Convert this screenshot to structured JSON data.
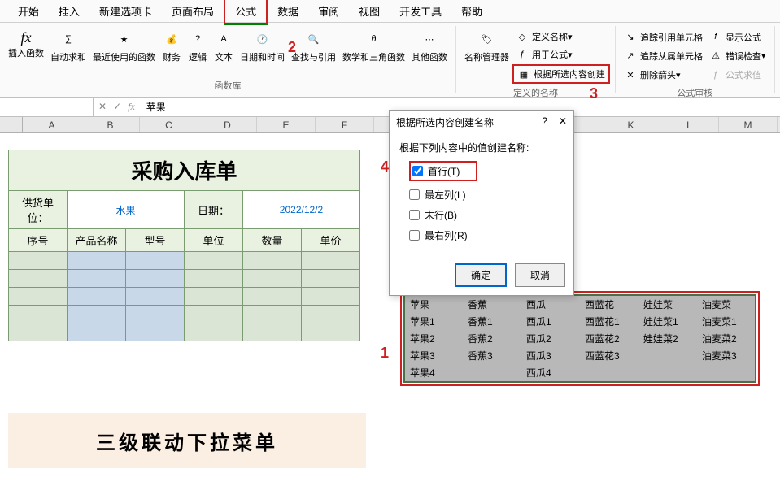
{
  "tabs": [
    "开始",
    "插入",
    "新建选项卡",
    "页面布局",
    "公式",
    "数据",
    "审阅",
    "视图",
    "开发工具",
    "帮助"
  ],
  "active_tab_index": 4,
  "ribbon": {
    "fx_insert": "插入函数",
    "autosum": "自动求和",
    "recent": "最近使用的函数",
    "financial": "财务",
    "logical": "逻辑",
    "text": "文本",
    "datetime": "日期和时间",
    "lookup": "查找与引用",
    "math": "数学和三角函数",
    "more": "其他函数",
    "group1_label": "函数库",
    "name_mgr": "名称管理器",
    "define_name": "定义名称",
    "use_in_formula": "用于公式",
    "create_from_selection": "根据所选内容创建",
    "group2_label": "定义的名称",
    "trace_precedents": "追踪引用单元格",
    "trace_dependents": "追踪从属单元格",
    "remove_arrows": "删除箭头",
    "show_formulas": "显示公式",
    "error_check": "错误检查",
    "evaluate": "公式求值",
    "group3_label": "公式审核"
  },
  "formula_bar": {
    "name_box": "",
    "value": "苹果"
  },
  "col_headers": [
    "A",
    "B",
    "C",
    "D",
    "E",
    "F",
    "K",
    "L",
    "M"
  ],
  "purchase": {
    "title": "采购入库单",
    "supplier_label": "供货单位：",
    "supplier_value": "水果",
    "date_label": "日期：",
    "date_value": "2022/12/2",
    "columns": [
      "序号",
      "产品名称",
      "型号",
      "单位",
      "数量",
      "单价"
    ]
  },
  "dialog": {
    "title": "根据所选内容创建名称",
    "help": "?",
    "close": "✕",
    "label": "根据下列内容中的值创建名称:",
    "opt1": "首行(T)",
    "opt2": "最左列(L)",
    "opt3": "末行(B)",
    "opt4": "最右列(R)",
    "ok": "确定",
    "cancel": "取消"
  },
  "chart_data": {
    "type": "table",
    "headers": [
      "苹果",
      "香蕉",
      "西瓜",
      "西蓝花",
      "娃娃菜",
      "油麦菜"
    ],
    "rows": [
      [
        "苹果1",
        "香蕉1",
        "西瓜1",
        "西蓝花1",
        "娃娃菜1",
        "油麦菜1"
      ],
      [
        "苹果2",
        "香蕉2",
        "西瓜2",
        "西蓝花2",
        "娃娃菜2",
        "油麦菜2"
      ],
      [
        "苹果3",
        "香蕉3",
        "西瓜3",
        "西蓝花3",
        "",
        "油麦菜3"
      ],
      [
        "苹果4",
        "",
        "西瓜4",
        "",
        "",
        ""
      ]
    ]
  },
  "annotations": {
    "a1": "1",
    "a2": "2",
    "a3": "3",
    "a4": "4"
  },
  "banner": "三级联动下拉菜单"
}
